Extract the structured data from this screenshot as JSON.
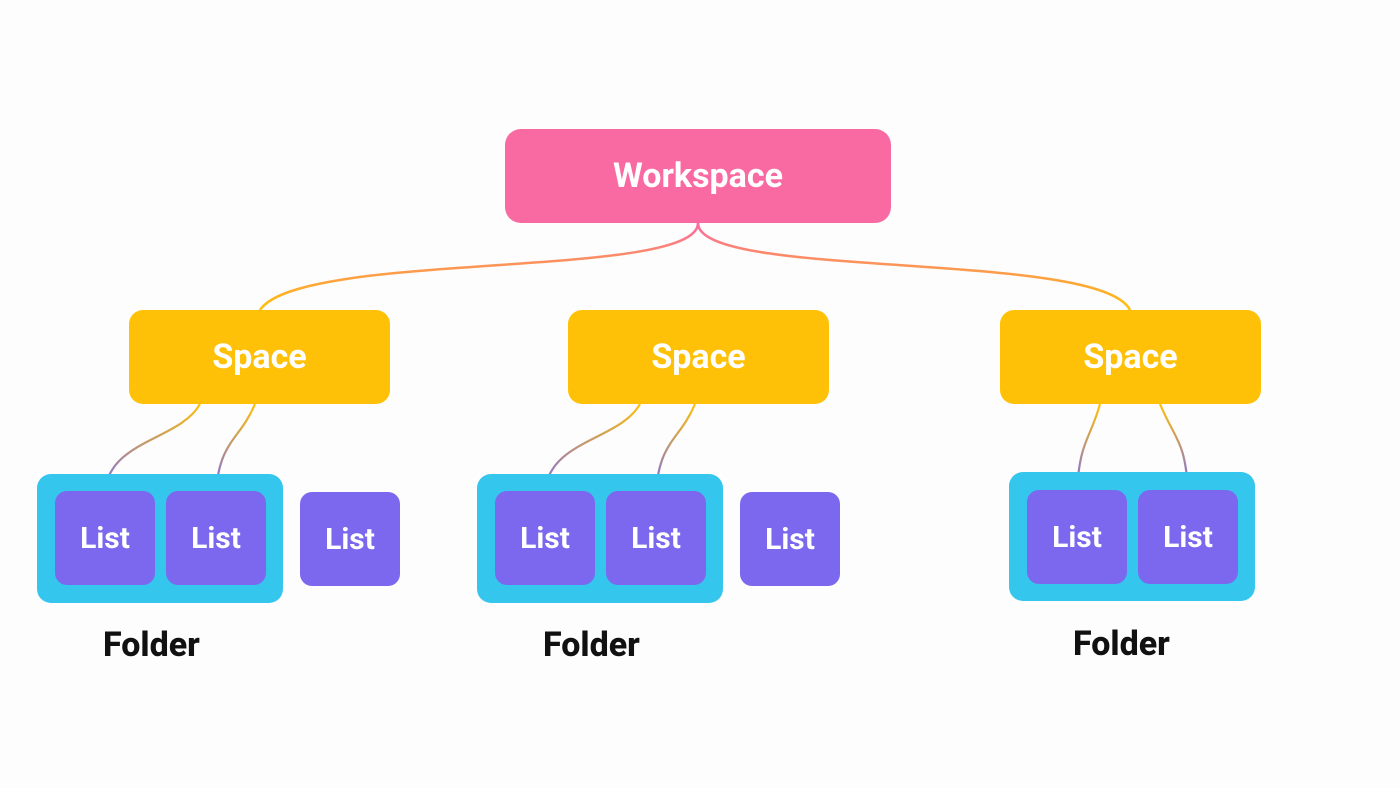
{
  "hierarchy": {
    "workspace_label": "Workspace",
    "spaces": [
      {
        "label": "Space"
      },
      {
        "label": "Space"
      },
      {
        "label": "Space"
      }
    ],
    "folders": [
      {
        "label": "Folder"
      },
      {
        "label": "Folder"
      },
      {
        "label": "Folder"
      }
    ],
    "lists": {
      "space1": {
        "in_folder": [
          "List",
          "List"
        ],
        "standalone": [
          "List"
        ]
      },
      "space2": {
        "in_folder": [
          "List",
          "List"
        ],
        "standalone": [
          "List"
        ]
      },
      "space3": {
        "in_folder": [
          "List",
          "List"
        ],
        "standalone": []
      }
    }
  },
  "colors": {
    "workspace": "#f96aa3",
    "space": "#ffc107",
    "folder": "#35c6ee",
    "list": "#7b68ee",
    "text_on_node": "#ffffff",
    "folder_label": "#111111",
    "background": "#fdfdfd"
  }
}
